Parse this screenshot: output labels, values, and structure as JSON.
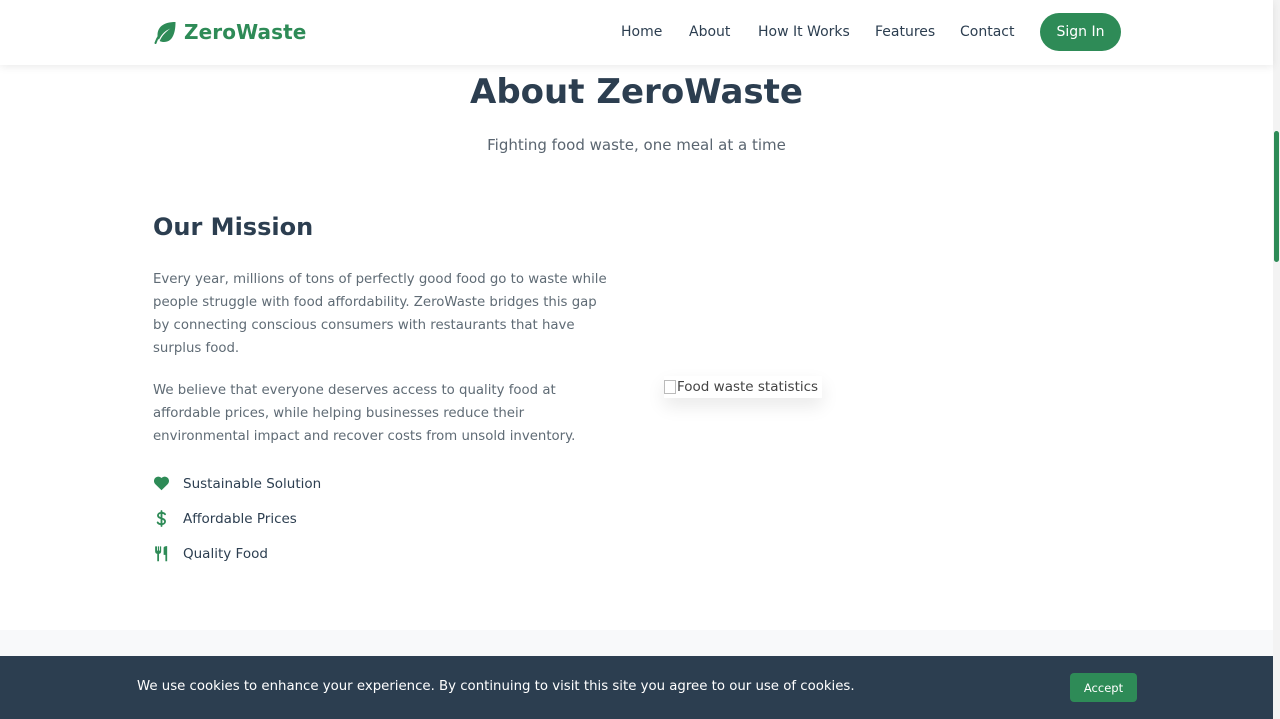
{
  "header": {
    "brand": "ZeroWaste",
    "nav": [
      "Home",
      "About",
      "How It Works",
      "Features",
      "Contact"
    ],
    "sign_in": "Sign In"
  },
  "hero": {
    "title": "About ZeroWaste",
    "subtitle": "Fighting food waste, one meal at a time"
  },
  "mission": {
    "title": "Our Mission",
    "paragraphs": [
      "Every year, millions of tons of perfectly good food go to waste while people struggle with food affordability. ZeroWaste bridges this gap by connecting conscious consumers with restaurants that have surplus food.",
      "We believe that everyone deserves access to quality food at affordable prices, while helping businesses reduce their environmental impact and recover costs from unsold inventory."
    ],
    "features": [
      {
        "icon": "heart-icon",
        "label": "Sustainable Solution"
      },
      {
        "icon": "dollar-icon",
        "label": "Affordable Prices"
      },
      {
        "icon": "utensils-icon",
        "label": "Quality Food"
      }
    ],
    "image_alt": "Food waste statistics"
  },
  "cookie": {
    "text": "We use cookies to enhance your experience. By continuing to visit this site you agree to our use of cookies.",
    "accept": "Accept"
  },
  "colors": {
    "brand": "#2e8b57",
    "dark": "#2c3e50",
    "muted": "#5f6b75"
  }
}
